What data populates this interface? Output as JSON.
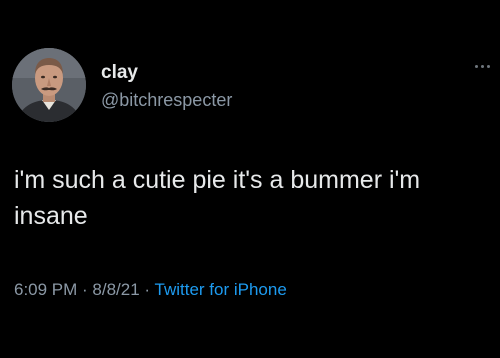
{
  "tweet": {
    "author": {
      "display_name": "clay",
      "handle": "@bitchrespecter",
      "avatar_icon": "profile-photo"
    },
    "text_line_1": "i'm such a cutie pie it's a bummer i'm",
    "text_line_2": "insane",
    "meta": {
      "time": "6:09 PM",
      "separator_1": " · ",
      "date": "8/8/21",
      "separator_2": " · ",
      "source": "Twitter for iPhone"
    },
    "more_icon": "more-horizontal-icon"
  },
  "colors": {
    "background": "#000000",
    "primary_text": "#e7e9ea",
    "secondary_text": "#8b98a5",
    "link": "#1d9bf0"
  }
}
